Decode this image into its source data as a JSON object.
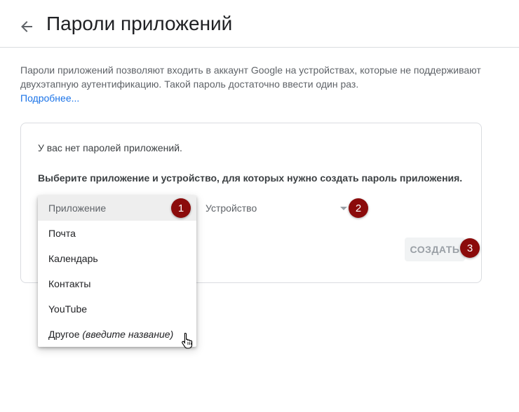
{
  "header": {
    "back_icon": "arrow-left-icon",
    "title": "Пароли приложений"
  },
  "description": {
    "text": "Пароли приложений позволяют входить в аккаунт Google на устройствах, которые не поддерживают двухэтапную аутентификацию. Такой пароль достаточно ввести один раз.",
    "learn_more": "Подробнее...",
    "link_color": "#1a73e8"
  },
  "card": {
    "no_passwords": "У вас нет паролей приложений.",
    "instruction": "Выберите приложение и устройство, для которых нужно создать пароль приложения.",
    "device_select": {
      "label": "Устройство",
      "icon": "dropdown-arrow-icon"
    },
    "create_button": "СОЗДАТЬ"
  },
  "app_menu": {
    "items": [
      {
        "label": "Приложение",
        "selected": true
      },
      {
        "label": "Почта"
      },
      {
        "label": "Календарь"
      },
      {
        "label": "Контакты"
      },
      {
        "label": "YouTube"
      },
      {
        "label": "Другое",
        "hint": "(введите название)"
      }
    ]
  },
  "badges": [
    "1",
    "2",
    "3"
  ],
  "badge_color": "#8b0b0b",
  "cursor_icon": "hand-pointer-icon"
}
